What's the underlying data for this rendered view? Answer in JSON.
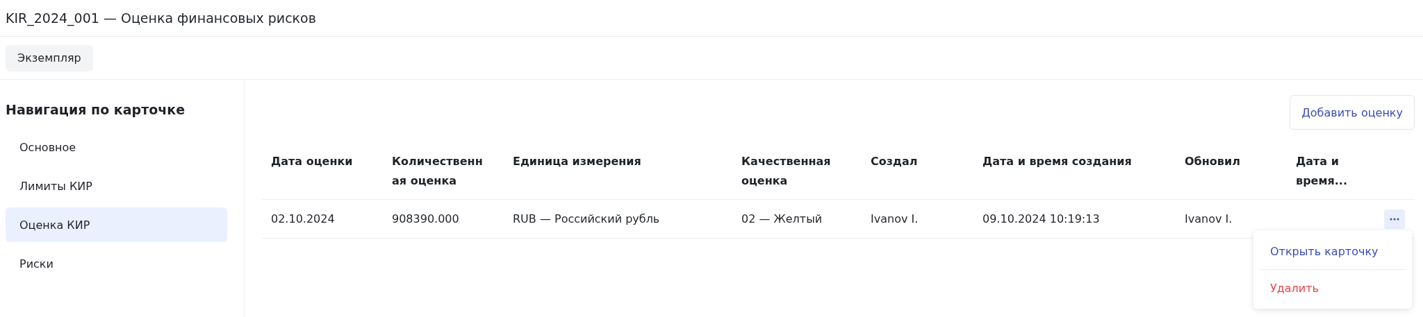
{
  "window": {
    "title": "KIR_2024_001 — Оценка финансовых рисков"
  },
  "tabs": [
    {
      "label": "Экземпляр",
      "selected": true
    }
  ],
  "sidebar": {
    "title": "Навигация по карточке",
    "items": [
      {
        "label": "Основное",
        "selected": false
      },
      {
        "label": "Лимиты КИР",
        "selected": false
      },
      {
        "label": "Оценка КИР",
        "selected": true
      },
      {
        "label": "Риски",
        "selected": false
      }
    ]
  },
  "toolbar": {
    "buttons": [
      "Добавить оценку"
    ]
  },
  "table": {
    "columns": [
      "Дата оценки",
      "Количественная оценка",
      "Единица измерения",
      "Качественная оценка",
      "Создал",
      "Дата и время создания",
      "Обновил",
      "Дата и время..."
    ],
    "rows": [
      [
        "02.10.2024",
        "908390.000",
        "RUB — Российский рубль",
        "02 — Желтый",
        "Ivanov I.",
        "09.10.2024 10:19:13",
        "Ivanov I.",
        ""
      ]
    ]
  },
  "row_menu": {
    "expanded": true,
    "items": [
      {
        "label": "Открыть карточку",
        "kind": "default"
      },
      {
        "label": "Удалить",
        "kind": "danger"
      }
    ]
  }
}
